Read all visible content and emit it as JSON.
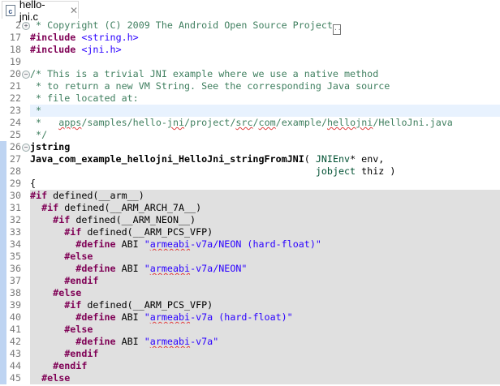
{
  "tab": {
    "title": "hello-jni.c",
    "icon": "c-file-icon",
    "close": "✕"
  },
  "colors": {
    "keyword": "#7f0055",
    "comment": "#3f7f5f",
    "string": "#2a00ff",
    "type": "#005032",
    "inactive_bg": "#e0e0e0",
    "current_line": "#e8f2fe"
  },
  "code": {
    "lines": [
      {
        "n": "2",
        "fold": "+",
        "folded": true,
        "tokens": [
          {
            "k": "cm",
            "t": " * Copyright (C) 2009 The Android Open Source Project"
          }
        ]
      },
      {
        "n": "17",
        "tokens": [
          {
            "k": "kw",
            "t": "#include"
          },
          {
            "k": "pl",
            "t": " "
          },
          {
            "k": "str",
            "t": "<string.h>"
          }
        ]
      },
      {
        "n": "18",
        "tokens": [
          {
            "k": "kw",
            "t": "#include"
          },
          {
            "k": "pl",
            "t": " "
          },
          {
            "k": "str",
            "t": "<jni.h>"
          }
        ]
      },
      {
        "n": "19",
        "tokens": []
      },
      {
        "n": "20",
        "fold": "−",
        "tokens": [
          {
            "k": "cm",
            "t": "/* This is a trivial JNI example where we use a native method"
          }
        ]
      },
      {
        "n": "21",
        "tokens": [
          {
            "k": "cm",
            "t": " * to return a new VM String. See the corresponding Java source"
          }
        ]
      },
      {
        "n": "22",
        "tokens": [
          {
            "k": "cm",
            "t": " * file located at:"
          }
        ]
      },
      {
        "n": "23",
        "hl": true,
        "tokens": [
          {
            "k": "cm",
            "t": " *"
          }
        ]
      },
      {
        "n": "24",
        "tokens": [
          {
            "k": "cm",
            "t": " *   "
          },
          {
            "k": "cm sp",
            "t": "apps"
          },
          {
            "k": "cm",
            "t": "/samples/hello-"
          },
          {
            "k": "cm sp",
            "t": "jni"
          },
          {
            "k": "cm",
            "t": "/project/"
          },
          {
            "k": "cm sp",
            "t": "src"
          },
          {
            "k": "cm",
            "t": "/"
          },
          {
            "k": "cm sp",
            "t": "com"
          },
          {
            "k": "cm",
            "t": "/example/"
          },
          {
            "k": "cm sp",
            "t": "hellojni"
          },
          {
            "k": "cm",
            "t": "/HelloJni.java"
          }
        ]
      },
      {
        "n": "25",
        "tokens": [
          {
            "k": "cm",
            "t": " */"
          }
        ]
      },
      {
        "n": "26",
        "fold": "−",
        "mark": true,
        "tokens": [
          {
            "k": "b",
            "t": "jstring"
          }
        ]
      },
      {
        "n": "27",
        "mark": true,
        "tokens": [
          {
            "k": "b",
            "t": "Java_com_example_hellojni_HelloJni_stringFromJNI"
          },
          {
            "k": "pl",
            "t": "( "
          },
          {
            "k": "ty",
            "t": "JNIEnv"
          },
          {
            "k": "pl",
            "t": "* env,"
          }
        ]
      },
      {
        "n": "28",
        "mark": true,
        "tokens": [
          {
            "k": "pl",
            "t": "                                                  "
          },
          {
            "k": "ty",
            "t": "jobject"
          },
          {
            "k": "pl",
            "t": " thiz )"
          }
        ]
      },
      {
        "n": "29",
        "mark": true,
        "tokens": [
          {
            "k": "pl",
            "t": "{"
          }
        ]
      },
      {
        "n": "30",
        "mark": true,
        "inactive": true,
        "tokens": [
          {
            "k": "kw",
            "t": "#if"
          },
          {
            "k": "pl",
            "t": " defined(__arm__)"
          }
        ]
      },
      {
        "n": "31",
        "mark": true,
        "inactive": true,
        "tokens": [
          {
            "k": "pl",
            "t": "  "
          },
          {
            "k": "kw",
            "t": "#if"
          },
          {
            "k": "pl",
            "t": " defined(__ARM_ARCH_7A__)"
          }
        ]
      },
      {
        "n": "32",
        "mark": true,
        "inactive": true,
        "tokens": [
          {
            "k": "pl",
            "t": "    "
          },
          {
            "k": "kw",
            "t": "#if"
          },
          {
            "k": "pl",
            "t": " defined(__ARM_NEON__)"
          }
        ]
      },
      {
        "n": "33",
        "mark": true,
        "inactive": true,
        "tokens": [
          {
            "k": "pl",
            "t": "      "
          },
          {
            "k": "kw",
            "t": "#if"
          },
          {
            "k": "pl",
            "t": " defined(__ARM_PCS_VFP)"
          }
        ]
      },
      {
        "n": "34",
        "mark": true,
        "inactive": true,
        "tokens": [
          {
            "k": "pl",
            "t": "        "
          },
          {
            "k": "kw",
            "t": "#define"
          },
          {
            "k": "pl",
            "t": " ABI "
          },
          {
            "k": "str",
            "t": "\""
          },
          {
            "k": "str sp",
            "t": "armeabi"
          },
          {
            "k": "str",
            "t": "-v7a/NEON (hard-float)\""
          }
        ]
      },
      {
        "n": "35",
        "mark": true,
        "inactive": true,
        "tokens": [
          {
            "k": "pl",
            "t": "      "
          },
          {
            "k": "kw",
            "t": "#else"
          }
        ]
      },
      {
        "n": "36",
        "mark": true,
        "inactive": true,
        "tokens": [
          {
            "k": "pl",
            "t": "        "
          },
          {
            "k": "kw",
            "t": "#define"
          },
          {
            "k": "pl",
            "t": " ABI "
          },
          {
            "k": "str",
            "t": "\""
          },
          {
            "k": "str sp",
            "t": "armeabi"
          },
          {
            "k": "str",
            "t": "-v7a/NEON\""
          }
        ]
      },
      {
        "n": "37",
        "mark": true,
        "inactive": true,
        "tokens": [
          {
            "k": "pl",
            "t": "      "
          },
          {
            "k": "kw",
            "t": "#endif"
          }
        ]
      },
      {
        "n": "38",
        "mark": true,
        "inactive": true,
        "tokens": [
          {
            "k": "pl",
            "t": "    "
          },
          {
            "k": "kw",
            "t": "#else"
          }
        ]
      },
      {
        "n": "39",
        "mark": true,
        "inactive": true,
        "tokens": [
          {
            "k": "pl",
            "t": "      "
          },
          {
            "k": "kw",
            "t": "#if"
          },
          {
            "k": "pl",
            "t": " defined(__ARM_PCS_VFP)"
          }
        ]
      },
      {
        "n": "40",
        "mark": true,
        "inactive": true,
        "tokens": [
          {
            "k": "pl",
            "t": "        "
          },
          {
            "k": "kw",
            "t": "#define"
          },
          {
            "k": "pl",
            "t": " ABI "
          },
          {
            "k": "str",
            "t": "\""
          },
          {
            "k": "str sp",
            "t": "armeabi"
          },
          {
            "k": "str",
            "t": "-v7a (hard-float)\""
          }
        ]
      },
      {
        "n": "41",
        "mark": true,
        "inactive": true,
        "tokens": [
          {
            "k": "pl",
            "t": "      "
          },
          {
            "k": "kw",
            "t": "#else"
          }
        ]
      },
      {
        "n": "42",
        "mark": true,
        "inactive": true,
        "tokens": [
          {
            "k": "pl",
            "t": "        "
          },
          {
            "k": "kw",
            "t": "#define"
          },
          {
            "k": "pl",
            "t": " ABI "
          },
          {
            "k": "str",
            "t": "\""
          },
          {
            "k": "str sp",
            "t": "armeabi"
          },
          {
            "k": "str",
            "t": "-v7a\""
          }
        ]
      },
      {
        "n": "43",
        "mark": true,
        "inactive": true,
        "tokens": [
          {
            "k": "pl",
            "t": "      "
          },
          {
            "k": "kw",
            "t": "#endif"
          }
        ]
      },
      {
        "n": "44",
        "mark": true,
        "inactive": true,
        "tokens": [
          {
            "k": "pl",
            "t": "    "
          },
          {
            "k": "kw",
            "t": "#endif"
          }
        ]
      },
      {
        "n": "45",
        "mark": true,
        "inactive": true,
        "tokens": [
          {
            "k": "pl",
            "t": "  "
          },
          {
            "k": "kw",
            "t": "#else"
          }
        ]
      }
    ]
  }
}
